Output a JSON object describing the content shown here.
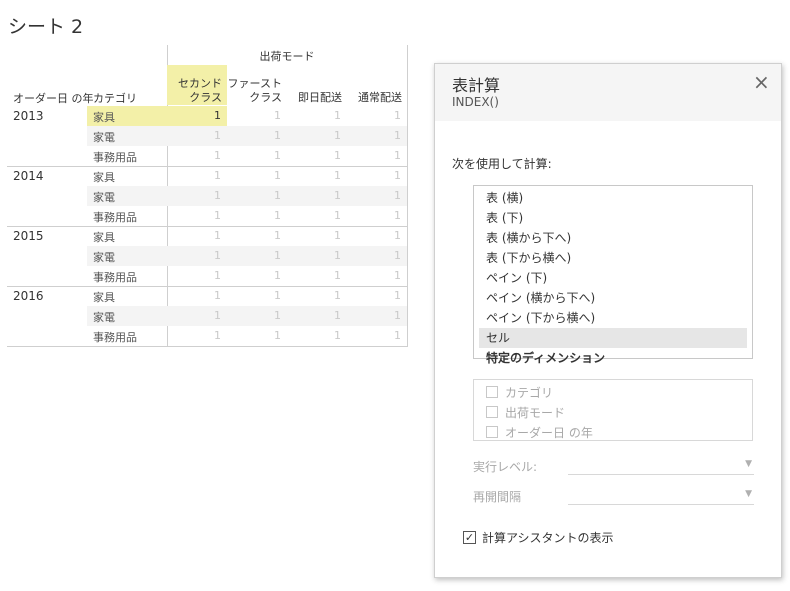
{
  "sheet": {
    "title": "シート 2"
  },
  "crosstab": {
    "column_group_header": "出荷モード",
    "row_headers": [
      "オーダー日 の年",
      "カテゴリ"
    ],
    "columns": [
      {
        "line1": "セカンド",
        "line2": "クラス"
      },
      {
        "line1": "ファースト",
        "line2": "クラス"
      },
      {
        "line1": "",
        "line2": "即日配送"
      },
      {
        "line1": "",
        "line2": "通常配送"
      }
    ],
    "years": [
      "2013",
      "2014",
      "2015",
      "2016"
    ],
    "categories": [
      "家具",
      "家電",
      "事務用品"
    ],
    "cell_value": "1",
    "highlight_color": "#f3f0a8"
  },
  "dialog": {
    "title": "表計算",
    "subtitle": "INDEX()",
    "close_icon": "×",
    "compute_using_label": "次を使用して計算:",
    "options": [
      "表 (横)",
      "表 (下)",
      "表 (横から下へ)",
      "表 (下から横へ)",
      "ペイン (下)",
      "ペイン (横から下へ)",
      "ペイン (下から横へ)",
      "セル",
      "特定のディメンション"
    ],
    "selected_option": "セル",
    "dimensions": [
      "カテゴリ",
      "出荷モード",
      "オーダー日 の年"
    ],
    "level_label": "実行レベル:",
    "restart_label": "再開間隔",
    "show_assistant_label": "計算アシスタントの表示",
    "show_assistant_checked": true
  }
}
